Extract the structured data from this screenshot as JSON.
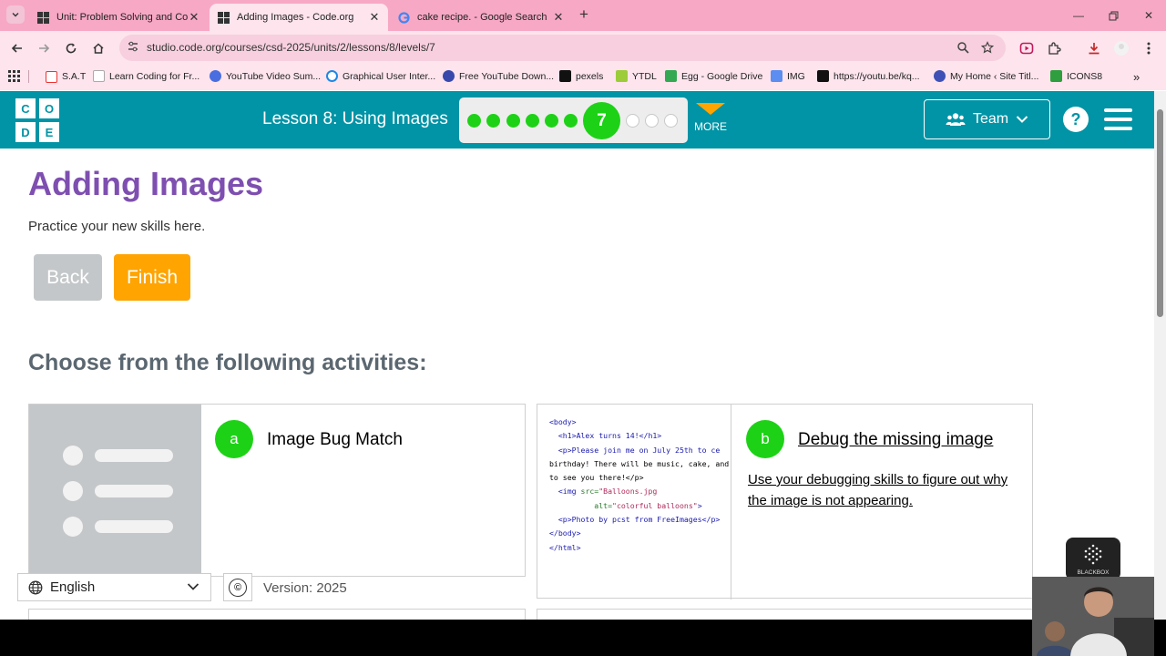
{
  "browser": {
    "tabs": [
      {
        "title": "Unit: Problem Solving and Com",
        "active": false
      },
      {
        "title": "Adding Images - Code.org",
        "active": true
      },
      {
        "title": "cake recipe. - Google Search",
        "active": false
      }
    ],
    "url": "studio.code.org/courses/csd-2025/units/2/lessons/8/levels/7",
    "bookmarks": [
      "S.A.T",
      "Learn Coding for Fr...",
      "YouTube Video Sum...",
      "Graphical User Inter...",
      "Free YouTube Down...",
      "pexels",
      "YTDL",
      "Egg - Google Drive",
      "IMG",
      "https://youtu.be/kq...",
      "My Home ‹ Site Titl...",
      "ICONS8"
    ]
  },
  "header": {
    "logo": [
      "C",
      "O",
      "D",
      "E"
    ],
    "lesson_title": "Lesson 8: Using Images",
    "current_level": "7",
    "levels_done": 6,
    "levels_remaining": 3,
    "more_label": "MORE",
    "team_label": "Team",
    "help_label": "?",
    "accent": "#0094a6"
  },
  "page": {
    "title": "Adding Images",
    "subtitle": "Practice your new skills here.",
    "back_label": "Back",
    "finish_label": "Finish",
    "choose_heading": "Choose from the following activities:"
  },
  "activities": [
    {
      "letter": "a",
      "title": "Image Bug Match",
      "description": ""
    },
    {
      "letter": "b",
      "title": "Debug the missing image",
      "description": "Use your debugging skills to figure out why the image is not appearing.",
      "code": {
        "body_open": "<body>",
        "h1": "<h1>Alex turns 14!</h1>",
        "p1a": "<p>Please join me on July 25th to ce",
        "p1b": "birthday! There will be music, cake, and",
        "p1c": "to see you there!</p>",
        "img_open": "<img ",
        "src_attr": "src=",
        "src_val": "\"Balloons.jpg",
        "alt_attr": "alt=",
        "alt_val": "\"colorful balloons\"",
        "img_close": ">",
        "p2": "<p>Photo by pcst from FreeImages</p>",
        "body_close": "</body>",
        "html_close": "</html>"
      }
    }
  ],
  "footer": {
    "language": "English",
    "copyright_symbol": "©",
    "version": "Version: 2025"
  },
  "overlay": {
    "blackbox_label": "BLACKBOX"
  }
}
